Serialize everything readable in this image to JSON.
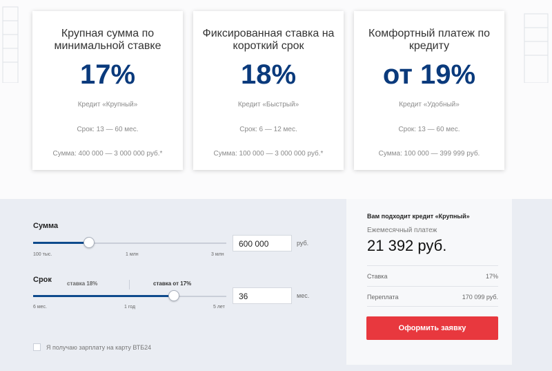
{
  "offers": [
    {
      "title": "Крупная сумма по минимальной ставке",
      "rate": "17%",
      "product": "Кредит «Крупный»",
      "term": "Срок:  13 — 60 мес.",
      "sum": "Сумма:  400 000 — 3 000 000 руб.*"
    },
    {
      "title": "Фиксированная ставка на короткий срок",
      "rate": "18%",
      "product": "Кредит «Быстрый»",
      "term": "Срок:  6 — 12 мес.",
      "sum": "Сумма:  100 000 — 3 000 000 руб.*"
    },
    {
      "title": "Комфортный платеж по кредиту",
      "rate": "от 19%",
      "product": "Кредит «Удобный»",
      "term": "Срок:  13 — 60 мес.",
      "sum": "Сумма:  100 000 — 399 999 руб."
    }
  ],
  "calculator": {
    "amount": {
      "label": "Сумма",
      "value": "600 000",
      "unit": "руб.",
      "ticks": [
        "100 тыс.",
        "1 млн",
        "3 млн"
      ],
      "slider_fraction": 0.29
    },
    "term": {
      "label": "Срок",
      "value": "36",
      "unit": "мес.",
      "ticks": [
        "6 мес.",
        "1 год",
        "5 лет"
      ],
      "rate_low": "ставка 18%",
      "rate_high": "ставка от 17%",
      "slider_fraction": 0.73
    },
    "salary_checkbox": {
      "label": "Я получаю зарплату на карту ВТБ24",
      "checked": false
    }
  },
  "result": {
    "title": "Вам подходит кредит «Крупный»",
    "payment_label": "Ежемесячный платеж",
    "payment_value": "21 392 руб.",
    "rows": [
      {
        "key": "Ставка",
        "value": "17%"
      },
      {
        "key": "Переплата",
        "value": "170 099 руб."
      }
    ],
    "apply_button": "Оформить заявку"
  },
  "colors": {
    "rate_blue": "#0a3a7c",
    "slider_fill": "#0e4a8c",
    "button_red": "#e8383e",
    "calc_background": "#eaedf3"
  }
}
